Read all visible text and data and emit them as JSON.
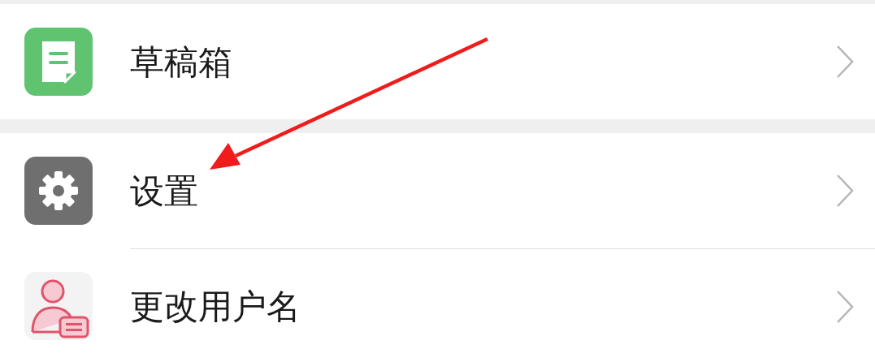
{
  "sections": [
    {
      "items": [
        {
          "label": "草稿箱",
          "kind": "drafts"
        }
      ]
    },
    {
      "items": [
        {
          "label": "设置",
          "kind": "settings"
        },
        {
          "label": "更改用户名",
          "kind": "rename"
        }
      ]
    }
  ]
}
